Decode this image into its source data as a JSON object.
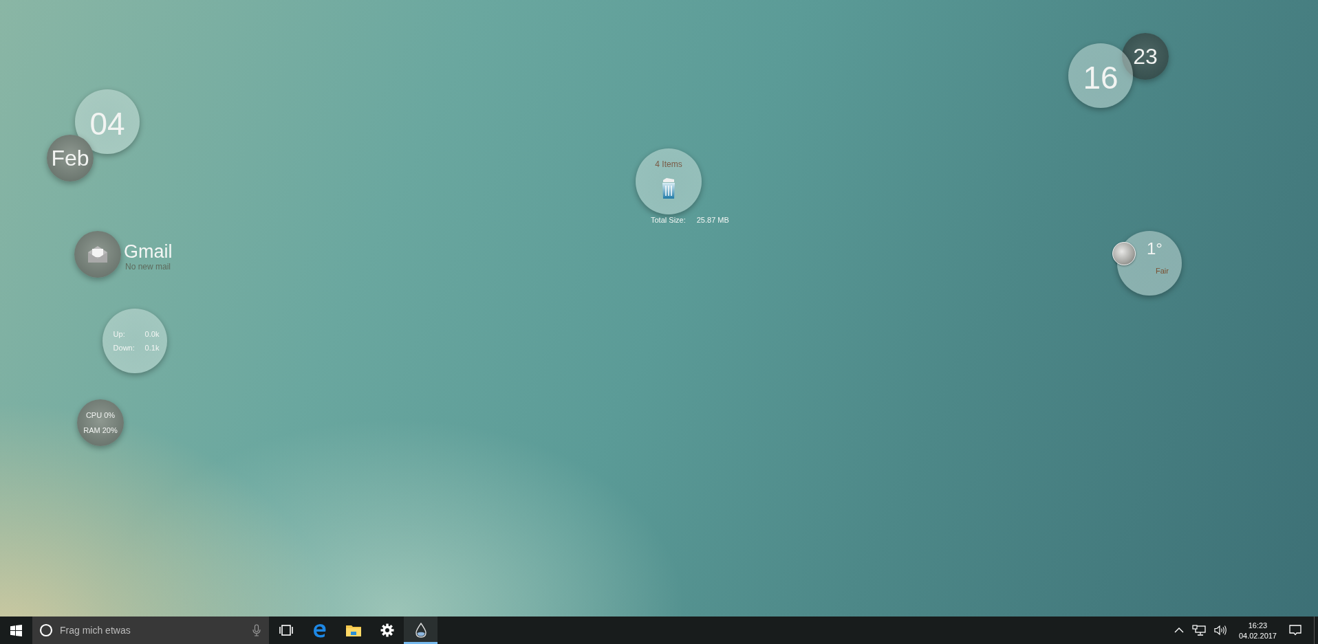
{
  "date": {
    "day": "04",
    "month": "Feb"
  },
  "clock": {
    "hour": "16",
    "minute": "23"
  },
  "gmail": {
    "title": "Gmail",
    "status": "No new mail"
  },
  "network": {
    "rows": [
      {
        "label": "Up:",
        "value": "0.0k"
      },
      {
        "label": "Down:",
        "value": "0.1k"
      }
    ]
  },
  "system": {
    "cpu": "CPU 0%",
    "ram": "RAM 20%"
  },
  "recycle_bin": {
    "items": "4 Items",
    "size_label": "Total Size:",
    "size_value": "25.87 MB"
  },
  "weather": {
    "temperature": "1°",
    "condition": "Fair"
  },
  "taskbar": {
    "search": {
      "placeholder": "Frag mich etwas"
    },
    "apps": [
      {
        "kind": "task-view",
        "selected": false
      },
      {
        "kind": "browser",
        "selected": false
      },
      {
        "kind": "folder",
        "selected": false
      },
      {
        "kind": "settings",
        "selected": false
      },
      {
        "kind": "drop",
        "selected": true
      }
    ],
    "time": "16:23",
    "date": "04.02.2017"
  }
}
